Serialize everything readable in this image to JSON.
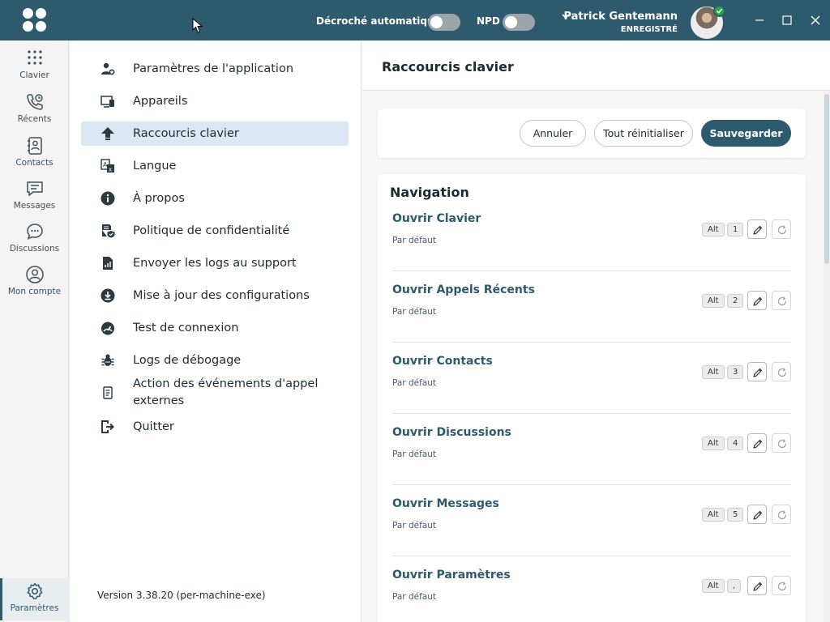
{
  "titlebar": {
    "auto_answer_label": "Décroché automatique",
    "npd_label": "NPD",
    "user_name": "Patrick Gentemann",
    "user_status": "ENREGISTRÉ",
    "brand_color": "#2e5a6e"
  },
  "rail": {
    "items": [
      {
        "label": "Clavier",
        "icon": "dialpad-icon"
      },
      {
        "label": "Récents",
        "icon": "recent-calls-icon"
      },
      {
        "label": "Contacts",
        "icon": "contacts-icon"
      },
      {
        "label": "Messages",
        "icon": "messages-icon"
      },
      {
        "label": "Discussions",
        "icon": "discussions-icon"
      },
      {
        "label": "Mon compte",
        "icon": "account-icon"
      }
    ],
    "settings_label": "Paramètres"
  },
  "menu": {
    "items": [
      {
        "label": "Paramètres de l'application",
        "icon": "user-settings-icon"
      },
      {
        "label": "Appareils",
        "icon": "devices-icon"
      },
      {
        "label": "Raccourcis clavier",
        "icon": "keyboard-shortcut-icon"
      },
      {
        "label": "Langue",
        "icon": "language-icon"
      },
      {
        "label": "À propos",
        "icon": "info-icon"
      },
      {
        "label": "Politique de confidentialité",
        "icon": "privacy-icon"
      },
      {
        "label": "Envoyer les logs au support",
        "icon": "send-logs-icon"
      },
      {
        "label": "Mise à jour des configurations",
        "icon": "download-icon"
      },
      {
        "label": "Test de connexion",
        "icon": "gauge-icon"
      },
      {
        "label": "Logs de débogage",
        "icon": "bug-icon"
      },
      {
        "label": "Action des événements d'appel externes",
        "icon": "document-icon"
      },
      {
        "label": "Quitter",
        "icon": "exit-icon"
      }
    ],
    "version": "Version 3.38.20 (per-machine-exe)"
  },
  "content": {
    "title": "Raccourcis clavier",
    "cancel_label": "Annuler",
    "reset_all_label": "Tout réinitialiser",
    "save_label": "Sauvegarder",
    "section_title": "Navigation",
    "shortcuts": [
      {
        "name": "Ouvrir Clavier",
        "sub": "Par défaut",
        "mod": "Alt",
        "key": "1"
      },
      {
        "name": "Ouvrir Appels Récents",
        "sub": "Par défaut",
        "mod": "Alt",
        "key": "2"
      },
      {
        "name": "Ouvrir Contacts",
        "sub": "Par défaut",
        "mod": "Alt",
        "key": "3"
      },
      {
        "name": "Ouvrir Discussions",
        "sub": "Par défaut",
        "mod": "Alt",
        "key": "4"
      },
      {
        "name": "Ouvrir Messages",
        "sub": "Par défaut",
        "mod": "Alt",
        "key": "5"
      },
      {
        "name": "Ouvrir Paramètres",
        "sub": "Par défaut",
        "mod": "Alt",
        "key": ","
      }
    ]
  }
}
